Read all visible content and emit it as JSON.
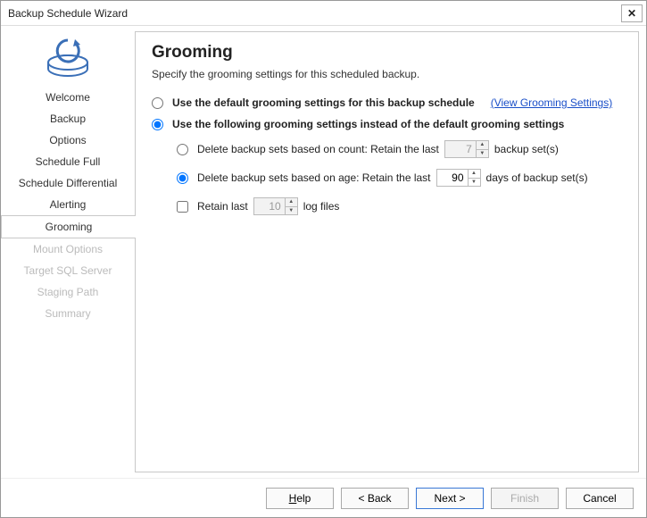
{
  "window": {
    "title": "Backup Schedule Wizard",
    "close": "✕"
  },
  "icon_name": "backup-box-icon",
  "nav": {
    "items": [
      {
        "label": "Welcome",
        "state": "normal"
      },
      {
        "label": "Backup",
        "state": "normal"
      },
      {
        "label": "Options",
        "state": "normal"
      },
      {
        "label": "Schedule Full",
        "state": "normal"
      },
      {
        "label": "Schedule Differential",
        "state": "normal"
      },
      {
        "label": "Alerting",
        "state": "normal"
      },
      {
        "label": "Grooming",
        "state": "active"
      },
      {
        "label": "Mount Options",
        "state": "disabled"
      },
      {
        "label": "Target SQL Server",
        "state": "disabled"
      },
      {
        "label": "Staging Path",
        "state": "disabled"
      },
      {
        "label": "Summary",
        "state": "disabled"
      }
    ]
  },
  "page": {
    "heading": "Grooming",
    "subtitle": "Specify the grooming settings for this scheduled backup.",
    "opt_default": "Use the default grooming settings for this backup schedule",
    "view_link": "(View Grooming Settings)",
    "opt_custom": "Use the following grooming settings instead of the default grooming settings",
    "selected_main": "custom",
    "by_count": {
      "prefix": "Delete backup sets based on count: Retain the last",
      "value": "7",
      "suffix": "backup set(s)",
      "selected": false
    },
    "by_age": {
      "prefix": "Delete backup sets based on age: Retain the last",
      "value": "90",
      "suffix": "days of backup set(s)",
      "selected": true
    },
    "retain_log": {
      "label_pre": "Retain last",
      "value": "10",
      "label_post": "log  files",
      "checked": false
    }
  },
  "footer": {
    "help": "Help",
    "back": "<  Back",
    "next": "Next  >",
    "finish": "Finish",
    "cancel": "Cancel",
    "finish_enabled": false
  }
}
